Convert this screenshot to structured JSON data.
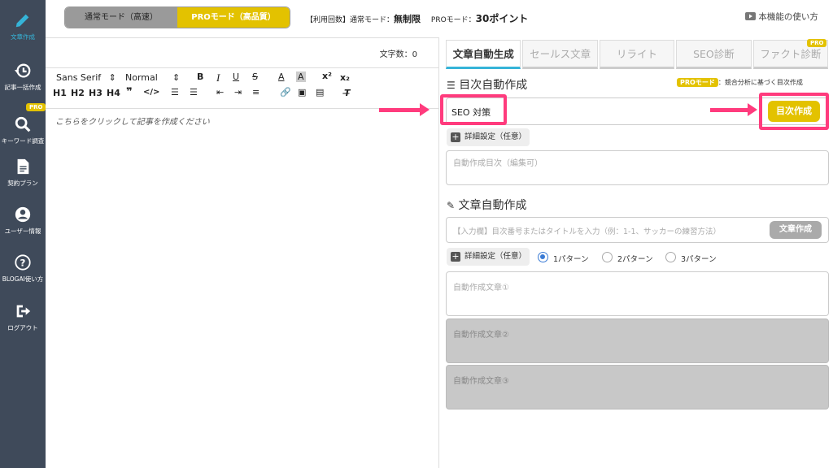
{
  "sidebar": {
    "items": [
      {
        "label": "文章作成",
        "icon": "pencil-icon"
      },
      {
        "label": "記事一括作成",
        "icon": "history-icon"
      },
      {
        "label": "キーワード調査",
        "icon": "search-icon",
        "badge": "PRO"
      },
      {
        "label": "契約プラン",
        "icon": "document-icon"
      },
      {
        "label": "ユーザー情報",
        "icon": "user-icon"
      },
      {
        "label": "BLOGAI使い方",
        "icon": "help-icon"
      },
      {
        "label": "ログアウト",
        "icon": "logout-icon"
      }
    ]
  },
  "header": {
    "mode_normal": "通常モード（高速）",
    "mode_pro": "PROモード（高品質）",
    "usage_prefix": "【利用回数】通常モード：",
    "usage_normal_value": "無制限",
    "usage_pro_prefix": "PROモード：",
    "usage_pro_value": "30ポイント",
    "howto": "本機能の使い方"
  },
  "editor": {
    "char_count": "文字数：0",
    "font_select": "Sans Serif",
    "size_select": "Normal",
    "headings": [
      "H1",
      "H2",
      "H3",
      "H4"
    ],
    "placeholder": "こちらをクリックして記事を作成ください"
  },
  "tabs": [
    {
      "label": "文章自動生成",
      "active": true
    },
    {
      "label": "セールス文章",
      "active": false
    },
    {
      "label": "リライト",
      "active": false
    },
    {
      "label": "SEO診断",
      "active": false
    },
    {
      "label": "ファクト診断",
      "active": false,
      "badge": "PRO"
    }
  ],
  "toc": {
    "title": "目次自動作成",
    "pro_badge": "PROモード",
    "pro_note": "：競合分析に基づく目次作成",
    "keyword_value": "SEO 対策",
    "create_button": "目次作成",
    "detail_button": "詳細設定（任意）",
    "output_placeholder": "自動作成目次（編集可）"
  },
  "article": {
    "title": "文章自動作成",
    "input_placeholder": "【入力欄】目次番号またはタイトルを入力（例：1-1、サッカーの練習方法）",
    "create_button": "文章作成",
    "detail_button": "詳細設定（任意）",
    "patterns": [
      "1パターン",
      "2パターン",
      "3パターン"
    ],
    "selected_pattern": "1パターン",
    "outputs": [
      "自動作成文章①",
      "自動作成文章②",
      "自動作成文章③"
    ]
  },
  "colors": {
    "sidebar": "#3f4a5a",
    "accent_blue": "#35b4d8",
    "pro_yellow": "#e3c200",
    "highlight_pink": "#ff3b7d"
  }
}
